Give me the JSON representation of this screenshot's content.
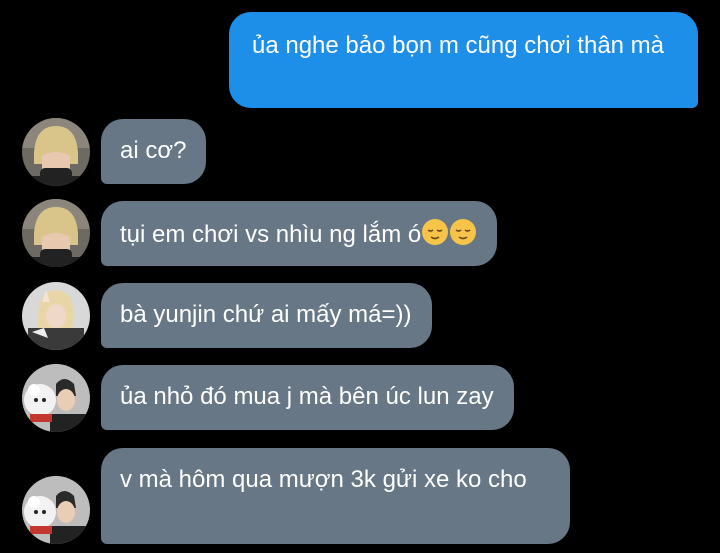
{
  "messages": [
    {
      "direction": "outgoing",
      "text": "ủa nghe bảo bọn m cũng chơi thân mà"
    },
    {
      "direction": "incoming",
      "text": "ai cơ?",
      "avatar": "blonde-masked-person"
    },
    {
      "direction": "incoming",
      "text": "tụi em chơi vs nhìu ng lắm ó",
      "emoji": [
        "relieved-face-emoji",
        "relieved-face-emoji"
      ],
      "avatar": "blonde-masked-person"
    },
    {
      "direction": "incoming",
      "text": "bà yunjin chứ ai mấy má=))",
      "avatar": "blonde-person-peace-sign"
    },
    {
      "direction": "incoming",
      "text": "ủa nhỏ đó mua j mà bên úc lun zay",
      "avatar": "person-with-white-poodle"
    },
    {
      "direction": "incoming",
      "text": "v mà hôm qua mượn 3k gửi xe ko cho",
      "avatar": "person-with-white-poodle"
    }
  ],
  "colors": {
    "background": "#000000",
    "outgoing_bubble": "#1e8fe8",
    "incoming_bubble": "#677786",
    "text": "#ffffff"
  }
}
